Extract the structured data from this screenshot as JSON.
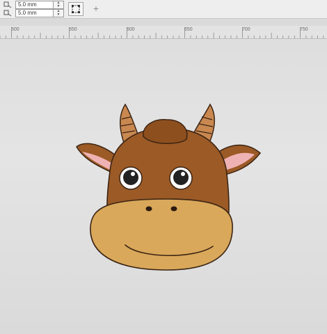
{
  "toolbar": {
    "width_field": {
      "value": "5.0 mm"
    },
    "height_field": {
      "value": "5.0 mm"
    }
  },
  "ruler": {
    "ticks": [
      "500",
      "550",
      "600",
      "650",
      "700",
      "750"
    ]
  },
  "colors": {
    "head": "#9b5a26",
    "muzzle": "#d9a85a",
    "horn": "#c98850",
    "ear_inner": "#efb2b4",
    "outline": "#3b2414"
  }
}
